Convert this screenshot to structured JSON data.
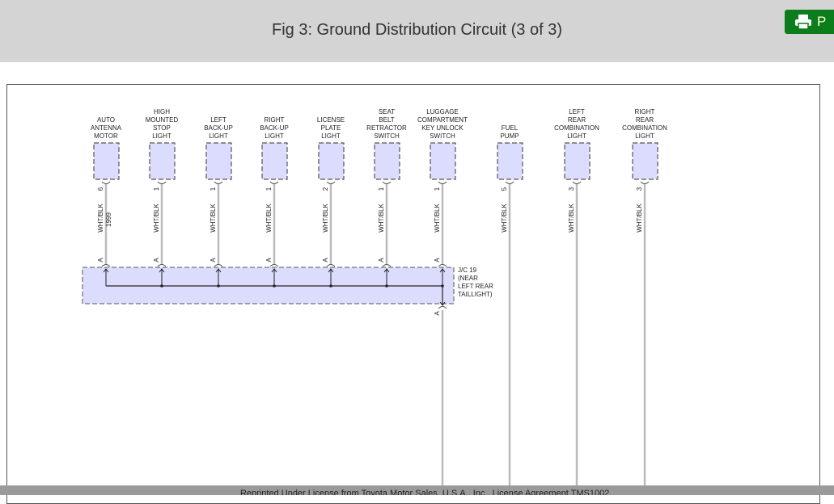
{
  "header": {
    "title": "Fig 3: Ground Distribution Circuit (3 of 3)",
    "print_label": "P"
  },
  "diagram": {
    "components": [
      {
        "label": [
          "AUTO",
          "ANTENNA",
          "MOTOR"
        ],
        "pin": "6",
        "wire": "WHT/BLK",
        "extra": "1999",
        "jc_pin": "A",
        "to_jc": true
      },
      {
        "label": [
          "HIGH",
          "MOUNTED",
          "STOP",
          "LIGHT"
        ],
        "pin": "1",
        "wire": "WHT/BLK",
        "jc_pin": "A",
        "to_jc": true
      },
      {
        "label": [
          "LEFT",
          "BACK-UP",
          "LIGHT"
        ],
        "pin": "1",
        "wire": "WHT/BLK",
        "jc_pin": "A",
        "to_jc": true
      },
      {
        "label": [
          "RIGHT",
          "BACK-UP",
          "LIGHT"
        ],
        "pin": "1",
        "wire": "WHT/BLK",
        "jc_pin": "A",
        "to_jc": true
      },
      {
        "label": [
          "LICENSE",
          "PLATE",
          "LIGHT"
        ],
        "pin": "2",
        "wire": "WHT/BLK",
        "jc_pin": "A",
        "to_jc": true
      },
      {
        "label": [
          "SEAT",
          "BELT",
          "RETRACTOR",
          "SWITCH"
        ],
        "pin": "1",
        "wire": "WHT/BLK",
        "jc_pin": "A",
        "to_jc": true
      },
      {
        "label": [
          "LUGGAGE",
          "COMPARTMENT",
          "KEY UNLOCK",
          "SWITCH"
        ],
        "pin": "1",
        "wire": "WHT/BLK",
        "jc_pin": "A",
        "to_jc": true
      },
      {
        "label": [
          "FUEL",
          "PUMP"
        ],
        "pin": "5",
        "wire": "WHT/BLK",
        "to_jc": false
      },
      {
        "label": [
          "LEFT",
          "REAR",
          "COMBINATION",
          "LIGHT"
        ],
        "pin": "3",
        "wire": "WHT/BLK",
        "to_jc": false
      },
      {
        "label": [
          "RIGHT",
          "REAR",
          "COMBINATION",
          "LIGHT"
        ],
        "pin": "3",
        "wire": "WHT/BLK",
        "to_jc": false
      }
    ],
    "junction": {
      "label": [
        "J/C 19",
        "(NEAR",
        "LEFT REAR",
        "TAILLIGHT)"
      ],
      "out_pin": "A"
    },
    "colors": {
      "box_fill": "#dcdcff",
      "box_stroke": "#555555",
      "wire": "#bbbbbb"
    }
  },
  "footer": {
    "text": "Reprinted Under License from Toyota Motor Sales, U.S.A., Inc., License Agreement TMS1002"
  }
}
